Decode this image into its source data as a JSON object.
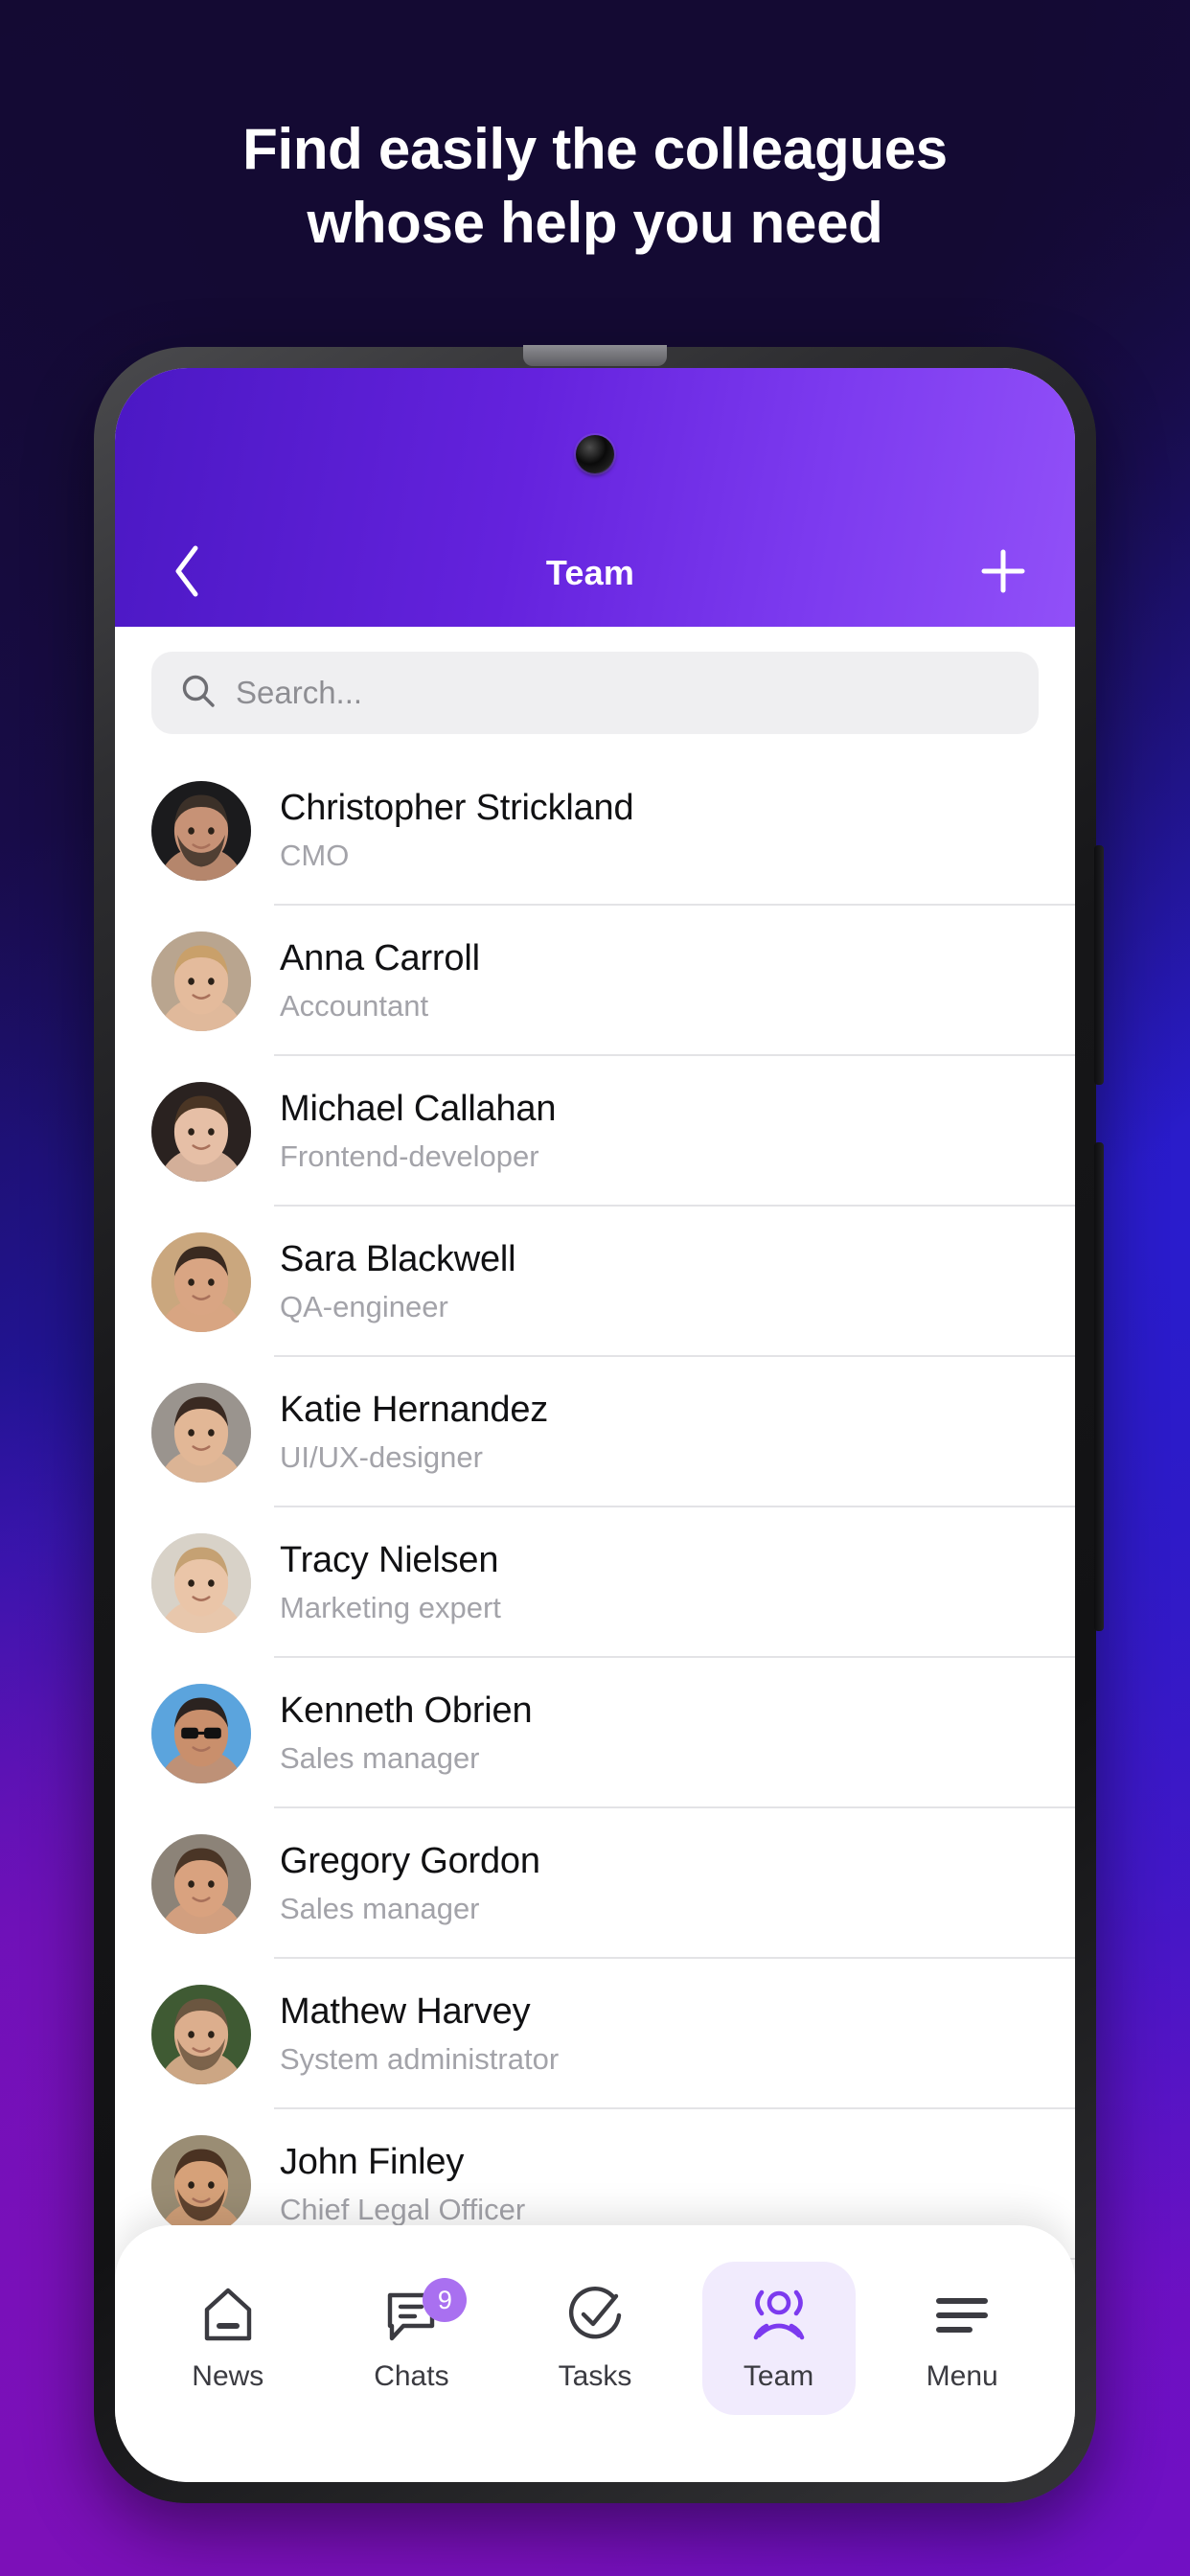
{
  "promo": {
    "headline": "Find easily the colleagues\nwhose help you need",
    "background_colors": {
      "deep_navy": "#140a33",
      "blue": "#2a1ccd",
      "purple": "#7c10b8"
    }
  },
  "app": {
    "header": {
      "title": "Team",
      "back_icon": "chevron-left-icon",
      "add_icon": "plus-icon",
      "gradient_from": "#4b18c4",
      "gradient_to": "#9150f8"
    },
    "search": {
      "icon": "search-icon",
      "placeholder": "Search...",
      "value": ""
    },
    "contacts": [
      {
        "name": "Christopher Strickland",
        "role": "CMO"
      },
      {
        "name": "Anna Carroll",
        "role": "Accountant"
      },
      {
        "name": "Michael Callahan",
        "role": "Frontend-developer"
      },
      {
        "name": "Sara Blackwell",
        "role": "QA-engineer"
      },
      {
        "name": "Katie Hernandez",
        "role": "UI/UX-designer"
      },
      {
        "name": "Tracy Nielsen",
        "role": "Marketing expert"
      },
      {
        "name": "Kenneth Obrien",
        "role": "Sales manager"
      },
      {
        "name": "Gregory Gordon",
        "role": "Sales manager"
      },
      {
        "name": "Mathew Harvey",
        "role": "System administrator"
      },
      {
        "name": "John Finley",
        "role": "Chief Legal Officer"
      }
    ],
    "tabbar": {
      "active": "Team",
      "accent": "#7c3aef",
      "badge_color": "#a970f0",
      "items": [
        {
          "label": "News",
          "icon": "home-icon",
          "badge": ""
        },
        {
          "label": "Chats",
          "icon": "chat-bubble-icon",
          "badge": "9"
        },
        {
          "label": "Tasks",
          "icon": "check-circle-icon",
          "badge": ""
        },
        {
          "label": "Team",
          "icon": "people-icon",
          "badge": ""
        },
        {
          "label": "Menu",
          "icon": "hamburger-icon",
          "badge": ""
        }
      ]
    }
  }
}
